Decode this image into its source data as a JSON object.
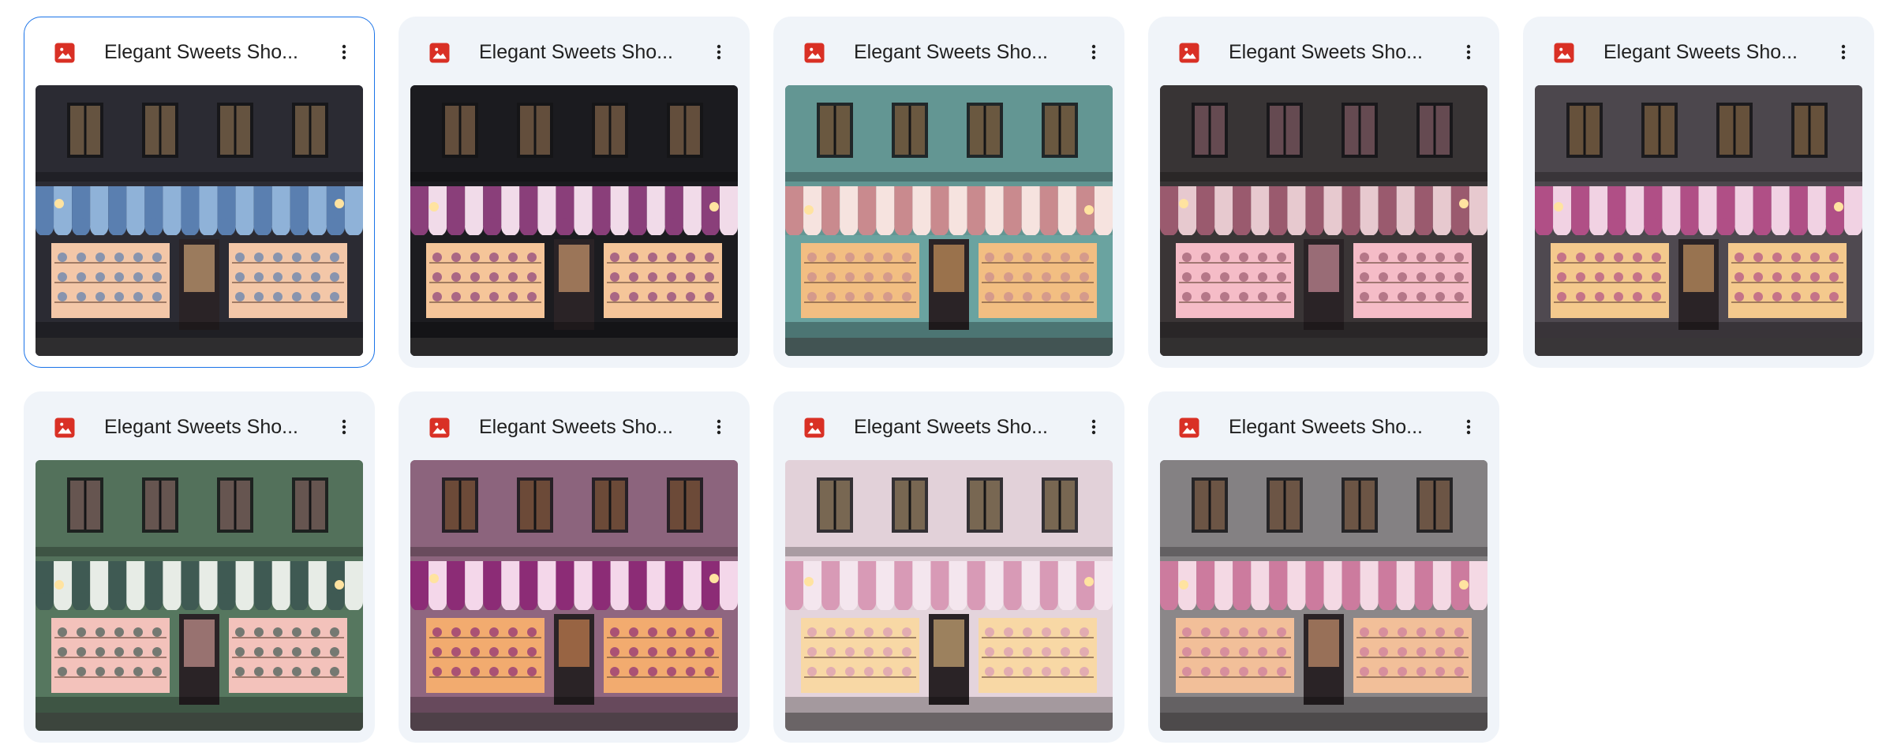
{
  "files": [
    {
      "title": "Elegant Sweets Sho...",
      "icon": "image-file-icon",
      "selected": true,
      "palette": {
        "sky": "#2a2c3a",
        "wall": "#2b2b33",
        "awning_a": "#5a7fb0",
        "awning_b": "#8fb2d8",
        "window": "#f2c9b8",
        "glow": "#f7c48a"
      }
    },
    {
      "title": "Elegant Sweets Sho...",
      "icon": "image-file-icon",
      "selected": false,
      "palette": {
        "sky": "#141518",
        "wall": "#1c1c20",
        "awning_a": "#8a3f7a",
        "awning_b": "#f1dbe9",
        "window": "#f5cba7",
        "glow": "#f7b982"
      }
    },
    {
      "title": "Elegant Sweets Sho...",
      "icon": "image-file-icon",
      "selected": false,
      "palette": {
        "sky": "#1e2426",
        "wall": "#6aa3a0",
        "awning_a": "#c98a8e",
        "awning_b": "#f6e3df",
        "window": "#f0c48e",
        "glow": "#f6b46c"
      }
    },
    {
      "title": "Elegant Sweets Sho...",
      "icon": "image-file-icon",
      "selected": false,
      "palette": {
        "sky": "#2b2a2c",
        "wall": "#3a3536",
        "awning_a": "#9a5a6e",
        "awning_b": "#e7c9cf",
        "window": "#f6c6cf",
        "glow": "#f4a9b8"
      }
    },
    {
      "title": "Elegant Sweets Sho...",
      "icon": "image-file-icon",
      "selected": false,
      "palette": {
        "sky": "#38343a",
        "wall": "#4f4950",
        "awning_a": "#b04f86",
        "awning_b": "#f1d2e3",
        "window": "#f6d39b",
        "glow": "#f2b673"
      }
    },
    {
      "title": "Elegant Sweets Sho...",
      "icon": "image-file-icon",
      "selected": false,
      "palette": {
        "sky": "#3b4436",
        "wall": "#56775f",
        "awning_a": "#3f5a53",
        "awning_b": "#e7ece6",
        "window": "#f4c9c4",
        "glow": "#f2b4ad"
      }
    },
    {
      "title": "Elegant Sweets Sho...",
      "icon": "image-file-icon",
      "selected": false,
      "palette": {
        "sky": "#6e5667",
        "wall": "#8f6680",
        "awning_a": "#8c2c76",
        "awning_b": "#f4d7ea",
        "window": "#f3b47a",
        "glow": "#f29b5b"
      }
    },
    {
      "title": "Elegant Sweets Sho...",
      "icon": "image-file-icon",
      "selected": false,
      "palette": {
        "sky": "#cbbac2",
        "wall": "#e4d4dc",
        "awning_a": "#d89ab6",
        "awning_b": "#f4e6ee",
        "window": "#f7ddb2",
        "glow": "#f9cf8c"
      }
    },
    {
      "title": "Elegant Sweets Sho...",
      "icon": "image-file-icon",
      "selected": false,
      "palette": {
        "sky": "#4b4a4e",
        "wall": "#8b8789",
        "awning_a": "#cc7b9e",
        "awning_b": "#f4d9e4",
        "window": "#f3c6a7",
        "glow": "#f2b181"
      }
    }
  ],
  "more_icon": "more-vertical-icon",
  "colors": {
    "card_bg": "#f0f4f9",
    "selected_border": "#1a73e8",
    "image_icon_red": "#d93025",
    "title_text": "#1f1f1f"
  }
}
